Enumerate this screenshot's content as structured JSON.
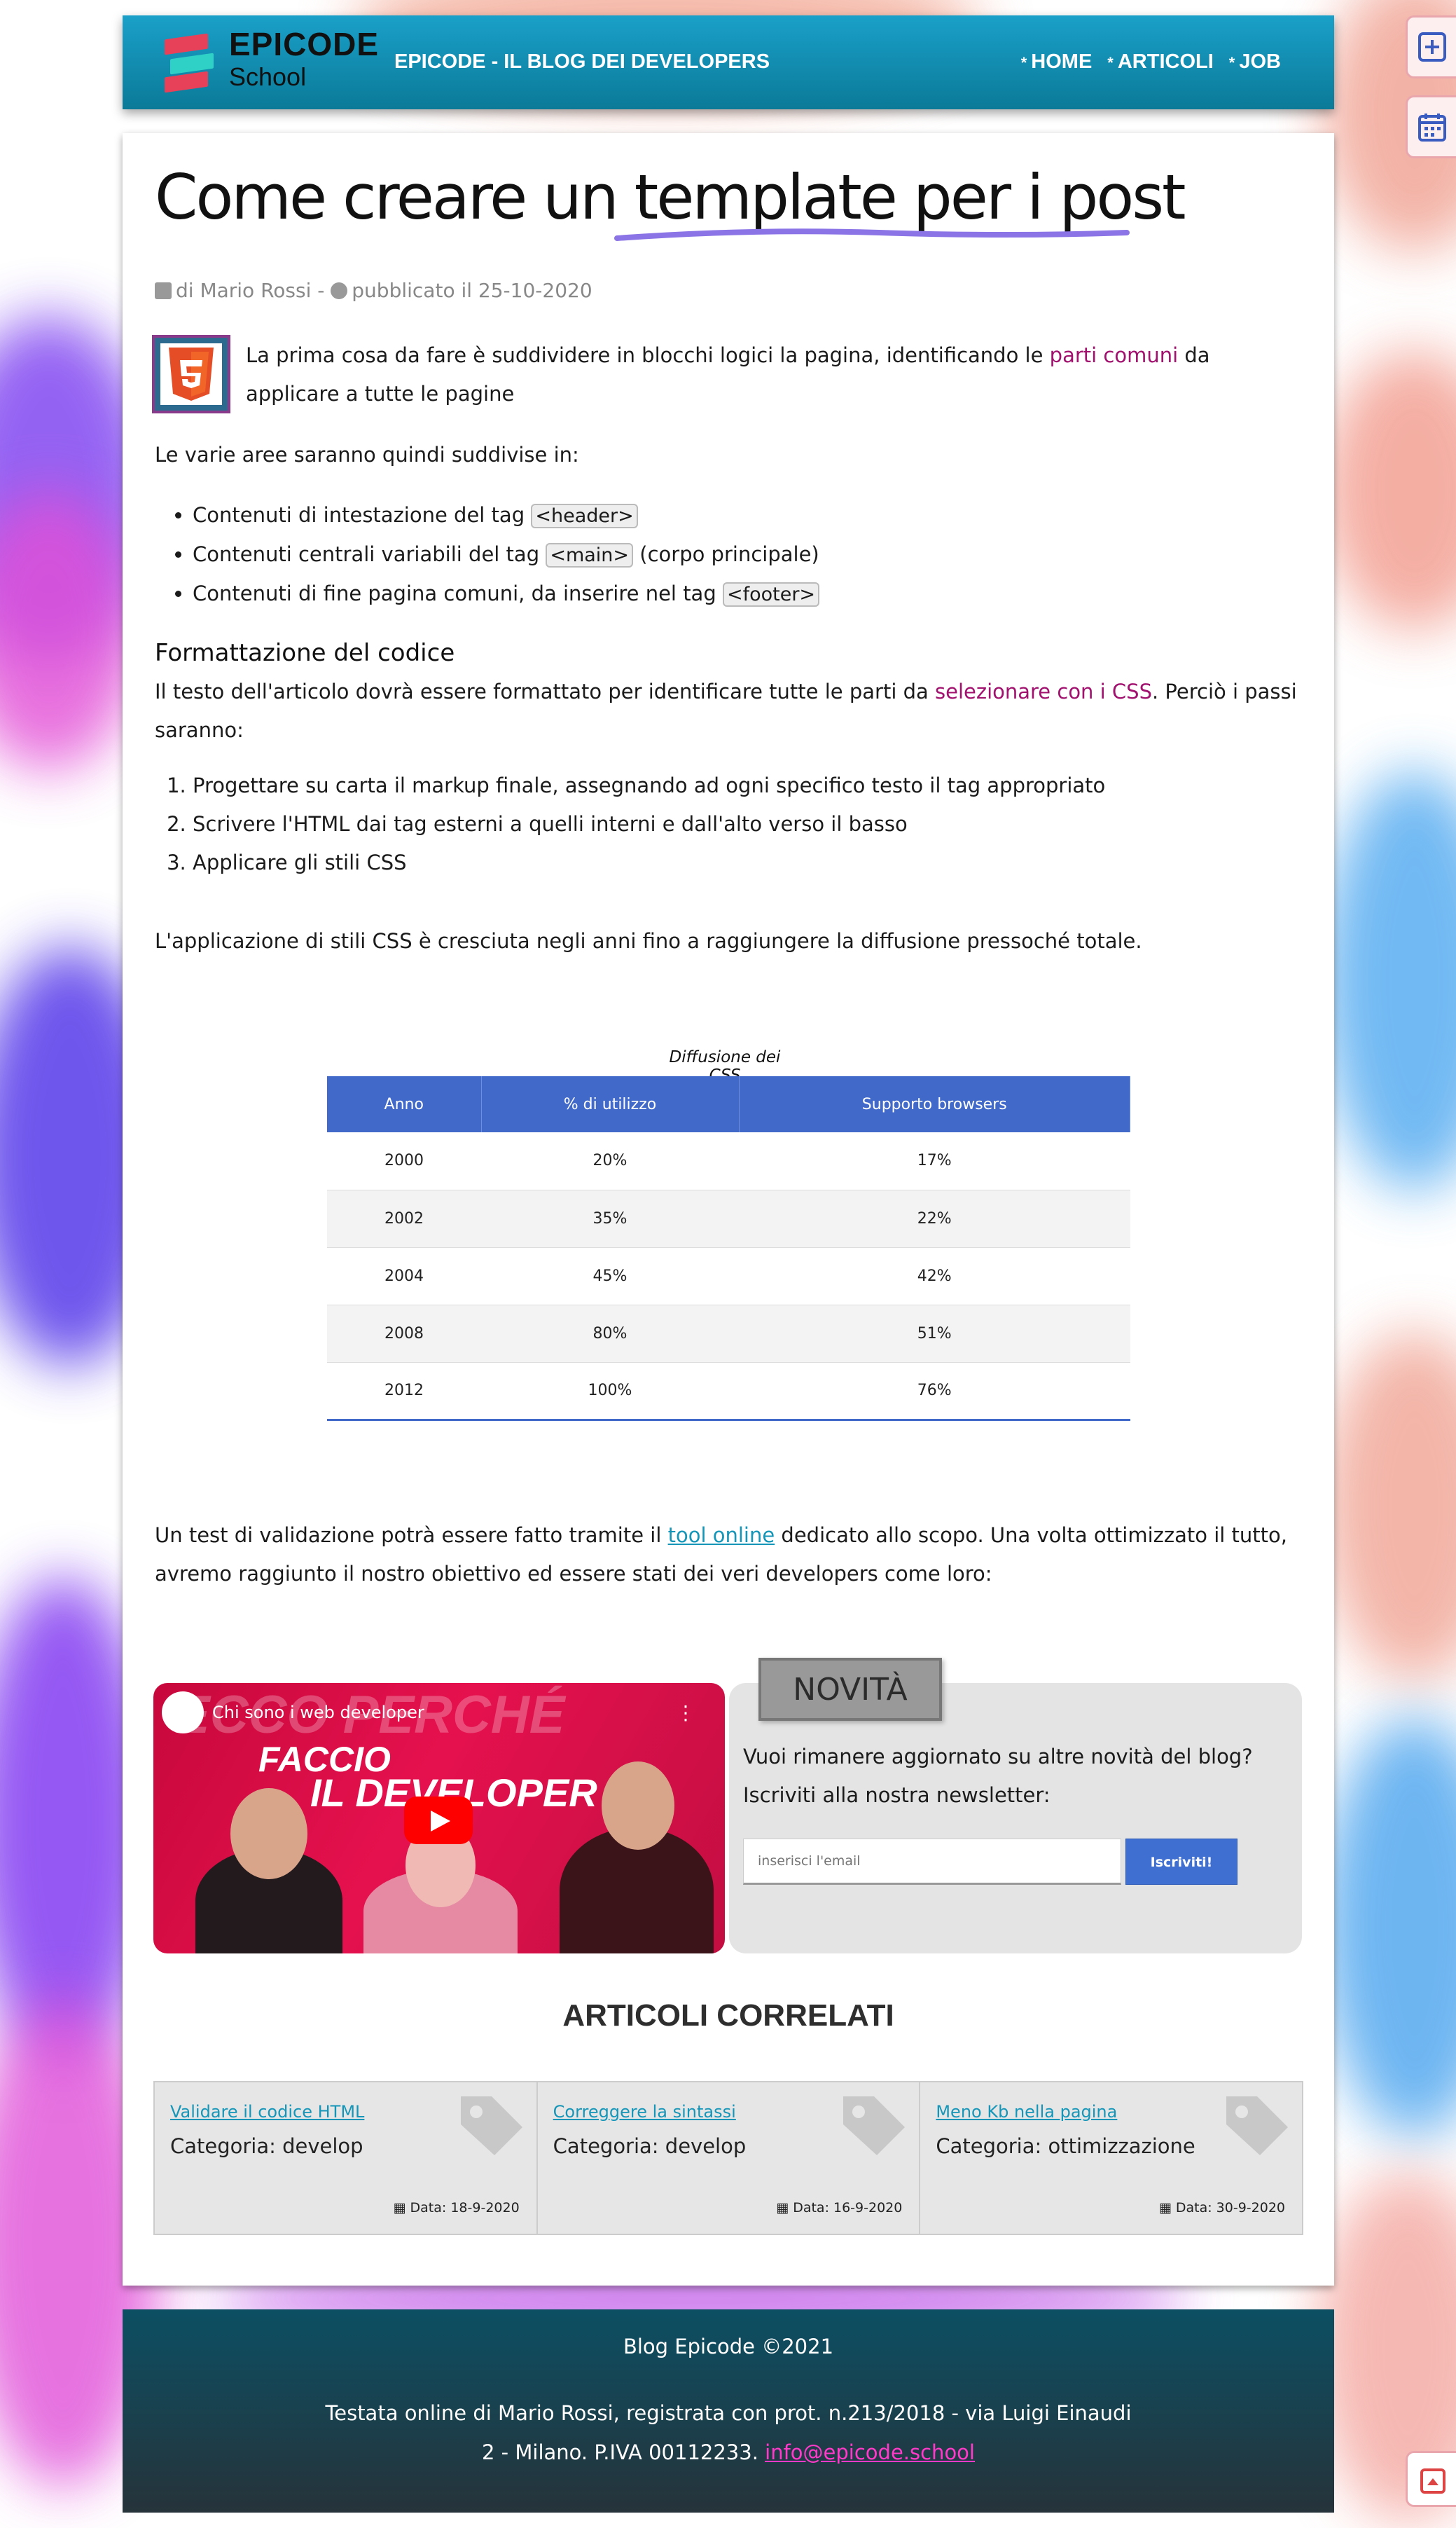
{
  "header": {
    "brand_line1": "EPICODE",
    "brand_line2": "School",
    "tagline": "EPICODE - IL BLOG DEI DEVELOPERS",
    "nav": [
      {
        "label": "HOME"
      },
      {
        "label": "ARTICOLI"
      },
      {
        "label": "JOB"
      }
    ]
  },
  "side": {
    "add_icon": "plus-square-icon",
    "calendar_icon": "calendar-icon",
    "back_top_icon": "caret-up-square-icon"
  },
  "article": {
    "title_part1": "Come creare un ",
    "title_part2": "template per i post",
    "meta_author": "di Mario Rossi",
    "meta_sep": " - ",
    "meta_published": "pubblicato il 25-10-2020",
    "intro_before": "La prima cosa da fare è suddividere in blocchi logici la pagina, identificando le ",
    "intro_link": "parti comuni",
    "intro_after": " da applicare a tutte le pagine",
    "p2": "Le varie aree saranno quindi suddivise in:",
    "list": [
      {
        "before": "Contenuti di intestazione del tag ",
        "code": "<header>",
        "after": ""
      },
      {
        "before": "Contenuti centrali variabili del tag ",
        "code": "<main>",
        "after": " (corpo principale)"
      },
      {
        "before": "Contenuti di fine pagina comuni, da inserire nel tag ",
        "code": "<footer>",
        "after": ""
      }
    ],
    "h3": "Formattazione del codice",
    "p3_before": "Il testo dell'articolo dovrà essere formattato per identificare tutte le parti da ",
    "p3_link": "selezionare con i CSS",
    "p3_after": ". Perciò i passi saranno:",
    "steps": [
      "Progettare su carta il markup finale, assegnando ad ogni specifico testo il tag appropriato",
      "Scrivere l'HTML dai tag esterni a quelli interni e dall'alto verso il basso",
      "Applicare gli stili CSS"
    ],
    "p4": "L'applicazione di stili CSS è cresciuta negli anni fino a raggiungere la diffusione pressoché totale.",
    "p5_before": "Un test di validazione potrà essere fatto tramite il ",
    "p5_link": "tool online",
    "p5_after": " dedicato allo scopo. Una volta ottimizzato il tutto, avremo raggiunto il nostro obiettivo ed essere stati dei veri developers come loro:"
  },
  "table": {
    "caption": "Diffusione dei CSS",
    "headers": [
      "Anno",
      "% di utilizzo",
      "Supporto browsers"
    ],
    "rows": [
      [
        "2000",
        "20%",
        "17%"
      ],
      [
        "2002",
        "35%",
        "22%"
      ],
      [
        "2004",
        "45%",
        "42%"
      ],
      [
        "2008",
        "80%",
        "51%"
      ],
      [
        "2012",
        "100%",
        "76%"
      ]
    ]
  },
  "video": {
    "title": "Chi sono i web developer",
    "bg_text": "ECCO PERCHÉ",
    "line1": "FACCIO",
    "line2": "IL DEVELOPER"
  },
  "newsletter": {
    "tab": "NOVITÀ",
    "text": "Vuoi rimanere aggiornato su altre novità del blog? Iscriviti alla nostra newsletter:",
    "placeholder": "inserisci l'email",
    "button": "Iscriviti!"
  },
  "related": {
    "heading": "ARTICOLI CORRELATI",
    "items": [
      {
        "title": "Validare il codice HTML",
        "category": "Categoria: develop",
        "date": "Data: 18-9-2020"
      },
      {
        "title": "Correggere la sintassi",
        "category": "Categoria: develop",
        "date": "Data: 16-9-2020"
      },
      {
        "title": "Meno Kb nella pagina",
        "category": "Categoria: ottimizzazione",
        "date": "Data: 30-9-2020"
      }
    ]
  },
  "footer": {
    "copyright": "Blog Epicode ©2021",
    "line1": "Testata online di Mario Rossi, registrata con prot. n.213/2018 - via Luigi Einaudi",
    "line2": "2 - Milano. P.IVA 00112233. ",
    "email": "info@epicode.school"
  },
  "colors": {
    "header": "#1aa0c9",
    "accent_purple": "#a1126f",
    "link_cyan": "#1596b8",
    "table_header": "#4169c9",
    "footer": "#0c4f63"
  }
}
